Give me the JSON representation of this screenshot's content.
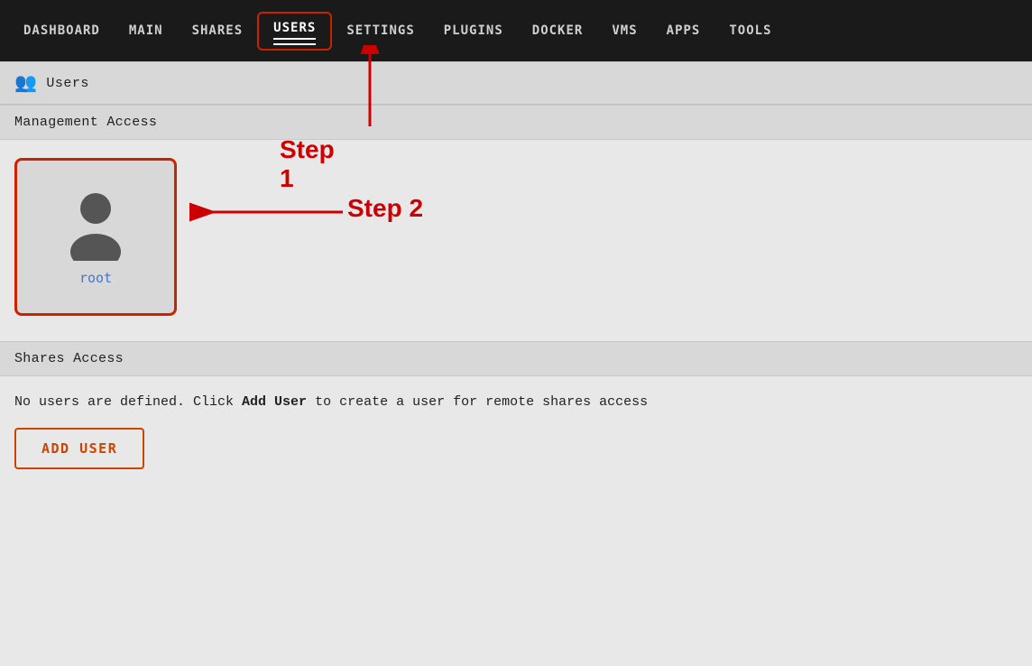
{
  "nav": {
    "items": [
      {
        "label": "DASHBOARD",
        "active": false
      },
      {
        "label": "MAIN",
        "active": false
      },
      {
        "label": "SHARES",
        "active": false
      },
      {
        "label": "USERS",
        "active": true
      },
      {
        "label": "SETTINGS",
        "active": false
      },
      {
        "label": "PLUGINS",
        "active": false
      },
      {
        "label": "DOCKER",
        "active": false
      },
      {
        "label": "VMS",
        "active": false
      },
      {
        "label": "APPS",
        "active": false
      },
      {
        "label": "TOOLS",
        "active": false
      }
    ]
  },
  "sections": {
    "users_header": "Users",
    "management_access": "Management Access",
    "shares_access": "Shares Access"
  },
  "user_card": {
    "name": "root"
  },
  "shares_section": {
    "message_prefix": "No users are defined. Click ",
    "message_bold": "Add User",
    "message_suffix": " to create a user for remote shares access"
  },
  "buttons": {
    "add_user": "ADD USER"
  },
  "annotations": {
    "step1": "Step 1",
    "step2": "Step 2"
  }
}
